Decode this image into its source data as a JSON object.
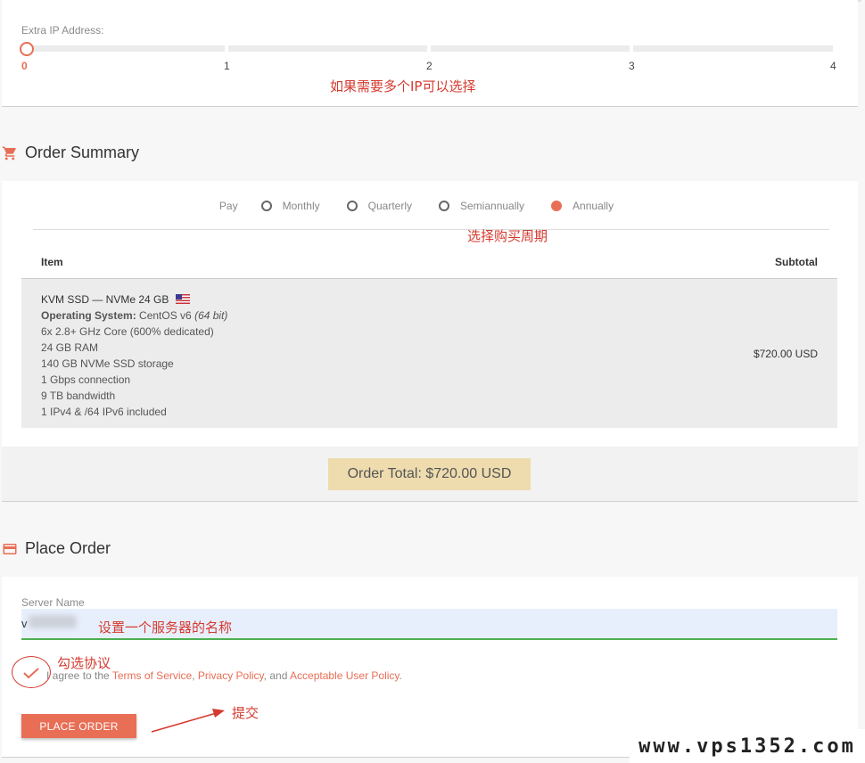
{
  "extra_ip": {
    "label": "Extra IP Address:",
    "ticks": [
      "0",
      "1",
      "2",
      "3",
      "4"
    ],
    "selected": 0
  },
  "annotations": {
    "multi_ip": "如果需要多个IP可以选择",
    "billing_cycle": "选择购买周期",
    "server_name": "设置一个服务器的名称",
    "check_agreement": "勾选协议",
    "submit": "提交"
  },
  "order_summary": {
    "title": "Order Summary",
    "pay_label": "Pay",
    "cycles": [
      {
        "label": "Monthly",
        "checked": false
      },
      {
        "label": "Quarterly",
        "checked": false
      },
      {
        "label": "Semiannually",
        "checked": false
      },
      {
        "label": "Annually",
        "checked": true
      }
    ],
    "col_item": "Item",
    "col_subtotal": "Subtotal",
    "item": {
      "name": "KVM SSD — NVMe 24 GB",
      "os_label": "Operating System:",
      "os_value": " CentOS v6 ",
      "os_bits": "(64 bit)",
      "specs": [
        "6x 2.8+ GHz Core (600% dedicated)",
        "24 GB RAM",
        "140 GB NVMe SSD storage",
        "1 Gbps connection",
        "9 TB bandwidth",
        "1 IPv4 & /64 IPv6 included"
      ],
      "subtotal": "$720.00 USD"
    },
    "total": "Order Total: $720.00 USD"
  },
  "place_order": {
    "title": "Place Order",
    "server_name_label": "Server Name",
    "server_name_value": "v",
    "agree_prefix": "I agree to the ",
    "tos": "Terms of Service",
    "sep1": ", ",
    "privacy": "Privacy Policy",
    "sep2": ", and ",
    "aup": "Acceptable User Policy",
    "agree_suffix": ".",
    "button": "PLACE ORDER"
  },
  "watermark": "www.vps1352.com",
  "colors": {
    "accent": "#e86e55",
    "annotation": "#d43a2f",
    "total_bg": "#eedcae",
    "input_bg": "#e8effc",
    "input_underline": "#4caf50"
  },
  "icons": {
    "order_summary": "cart-icon",
    "place_order": "credit-card-icon"
  }
}
